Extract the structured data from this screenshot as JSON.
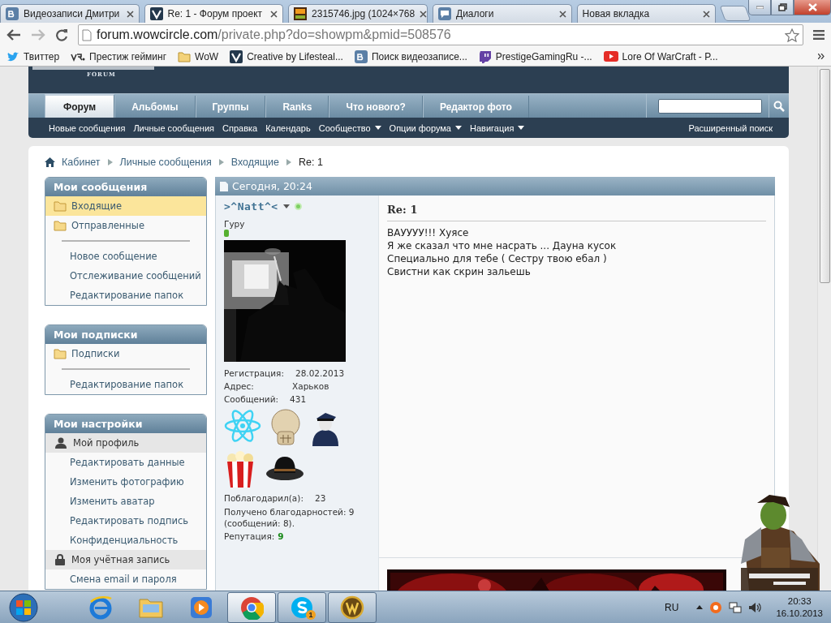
{
  "browser": {
    "tabs": [
      {
        "title": "Видеозаписи Дмитри",
        "selected": false
      },
      {
        "title": "Re: 1 - Форум проект",
        "selected": true
      },
      {
        "title": "2315746.jpg (1024×768",
        "selected": false
      },
      {
        "title": "Диалоги",
        "selected": false
      },
      {
        "title": "Новая вкладка",
        "selected": false
      }
    ],
    "url": {
      "domain": "forum.wowcircle.com",
      "path": "/private.php?do=showpm&pmid=508576"
    },
    "bookmarks": [
      "Твиттер",
      "Престиж гейминг",
      "WoW",
      "Creative by Lifesteal...",
      "Поиск видеозаписе...",
      "PrestigeGamingRu -...",
      "Lore Of WarCraft - P..."
    ]
  },
  "forum": {
    "logo_caption": "FORUM",
    "nav_tabs": [
      {
        "label": "Форум",
        "selected": true
      },
      {
        "label": "Альбомы",
        "selected": false
      },
      {
        "label": "Группы",
        "selected": false
      },
      {
        "label": "Ranks",
        "selected": false
      },
      {
        "label": "Что нового?",
        "selected": false
      },
      {
        "label": "Редактор фото",
        "selected": false
      }
    ],
    "subnav": [
      {
        "label": "Новые сообщения",
        "dropdown": false
      },
      {
        "label": "Личные сообщения",
        "dropdown": false
      },
      {
        "label": "Справка",
        "dropdown": false
      },
      {
        "label": "Календарь",
        "dropdown": false
      },
      {
        "label": "Сообщество",
        "dropdown": true
      },
      {
        "label": "Опции форума",
        "dropdown": true
      },
      {
        "label": "Навигация",
        "dropdown": true
      }
    ],
    "advanced_search": "Расширенный поиск",
    "breadcrumb": [
      "Кабинет",
      "Личные сообщения",
      "Входящие"
    ],
    "current_page": "Re: 1"
  },
  "sidebar": [
    {
      "title": "Мои сообщения",
      "items": [
        {
          "kind": "folder",
          "label": "Входящие",
          "selected": true
        },
        {
          "kind": "folder",
          "label": "Отправленные",
          "selected": false
        },
        {
          "kind": "divider"
        },
        {
          "kind": "link",
          "label": "Новое сообщение",
          "selected": false
        },
        {
          "kind": "link",
          "label": "Отслеживание сообщений",
          "selected": false
        },
        {
          "kind": "link",
          "label": "Редактирование папок",
          "selected": false
        }
      ]
    },
    {
      "title": "Мои подписки",
      "items": [
        {
          "kind": "folder",
          "label": "Подписки",
          "selected": false
        },
        {
          "kind": "divider"
        },
        {
          "kind": "link",
          "label": "Редактирование папок",
          "selected": false
        }
      ]
    },
    {
      "title": "Мои настройки",
      "items": [
        {
          "kind": "group",
          "label": "Мой профиль"
        },
        {
          "kind": "link",
          "label": "Редактировать данные",
          "selected": false
        },
        {
          "kind": "link",
          "label": "Изменить фотографию",
          "selected": false
        },
        {
          "kind": "link",
          "label": "Изменить аватар",
          "selected": false
        },
        {
          "kind": "link",
          "label": "Редактировать подпись",
          "selected": false
        },
        {
          "kind": "link",
          "label": "Конфиденциальность",
          "selected": false
        },
        {
          "kind": "group",
          "label": "Моя учётная запись"
        },
        {
          "kind": "link",
          "label": "Смена email и пароля",
          "selected": false
        }
      ]
    }
  ],
  "post": {
    "date": "Сегодня, 20:24",
    "author": ">^Natt^<",
    "online": true,
    "rank": "Гуру",
    "stats": [
      {
        "label": "Регистрация:",
        "value": "28.02.2013"
      },
      {
        "label": "Адрес:",
        "value": "Харьков"
      },
      {
        "label": "Сообщений:",
        "value": "431"
      }
    ],
    "thanked": {
      "label": "Поблагодарил(а):",
      "value": "23"
    },
    "thanks_received": "Получено благодарностей: 9 (сообщений: 8).",
    "reputation": {
      "label": "Репутация:",
      "value": "9"
    },
    "title": "Re: 1",
    "lines": [
      "ВАУУУУ!!! Хуясе",
      "Я же сказал что мне насрать ... Дауна кусок",
      "Специально для тебе ( Сестру твою ебал )",
      "Свистни как скрин зальешь"
    ]
  },
  "taskbar": {
    "apps": [
      {
        "running": false,
        "active": false
      },
      {
        "running": false,
        "active": false
      },
      {
        "running": false,
        "active": false
      },
      {
        "running": true,
        "active": true
      },
      {
        "running": true,
        "active": false,
        "badge": "1"
      },
      {
        "running": true,
        "active": false
      }
    ],
    "language": "RU",
    "time": "20:33",
    "date": "16.10.2013"
  }
}
